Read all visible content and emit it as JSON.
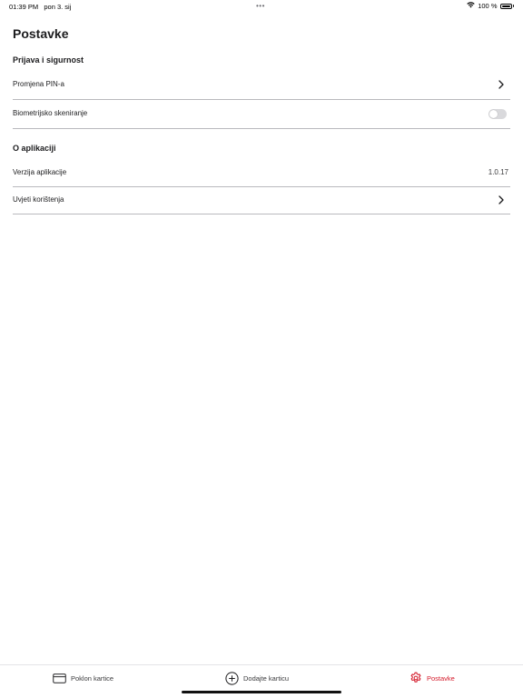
{
  "status_bar": {
    "time": "01:39 PM",
    "date": "pon 3. sij",
    "dots": "•••",
    "battery": "100 %"
  },
  "page": {
    "title": "Postavke"
  },
  "sections": [
    {
      "title": "Prijava i sigurnost",
      "rows": [
        {
          "label": "Promjena PIN-a",
          "accessory": "chevron-right-icon"
        },
        {
          "label": "Biometrijsko skeniranje",
          "accessory": "toggle",
          "toggle_on": false
        }
      ]
    },
    {
      "title": "O aplikaciji",
      "rows": [
        {
          "label": "Verzija aplikacije",
          "value": "1.0.17"
        },
        {
          "label": "Uvjeti korištenja",
          "accessory": "chevron-right-icon"
        }
      ]
    }
  ],
  "tab_bar": {
    "tabs": [
      {
        "label": "Poklon kartice",
        "icon": "card-icon",
        "active": false
      },
      {
        "label": "Dodajte karticu",
        "icon": "plus-circle-icon",
        "active": false
      },
      {
        "label": "Postavke",
        "icon": "gear-icon",
        "active": true
      }
    ]
  },
  "colors": {
    "accent": "#d41a2a",
    "divider": "#b9b9bd",
    "toggle_off": "#d9d9dc"
  }
}
